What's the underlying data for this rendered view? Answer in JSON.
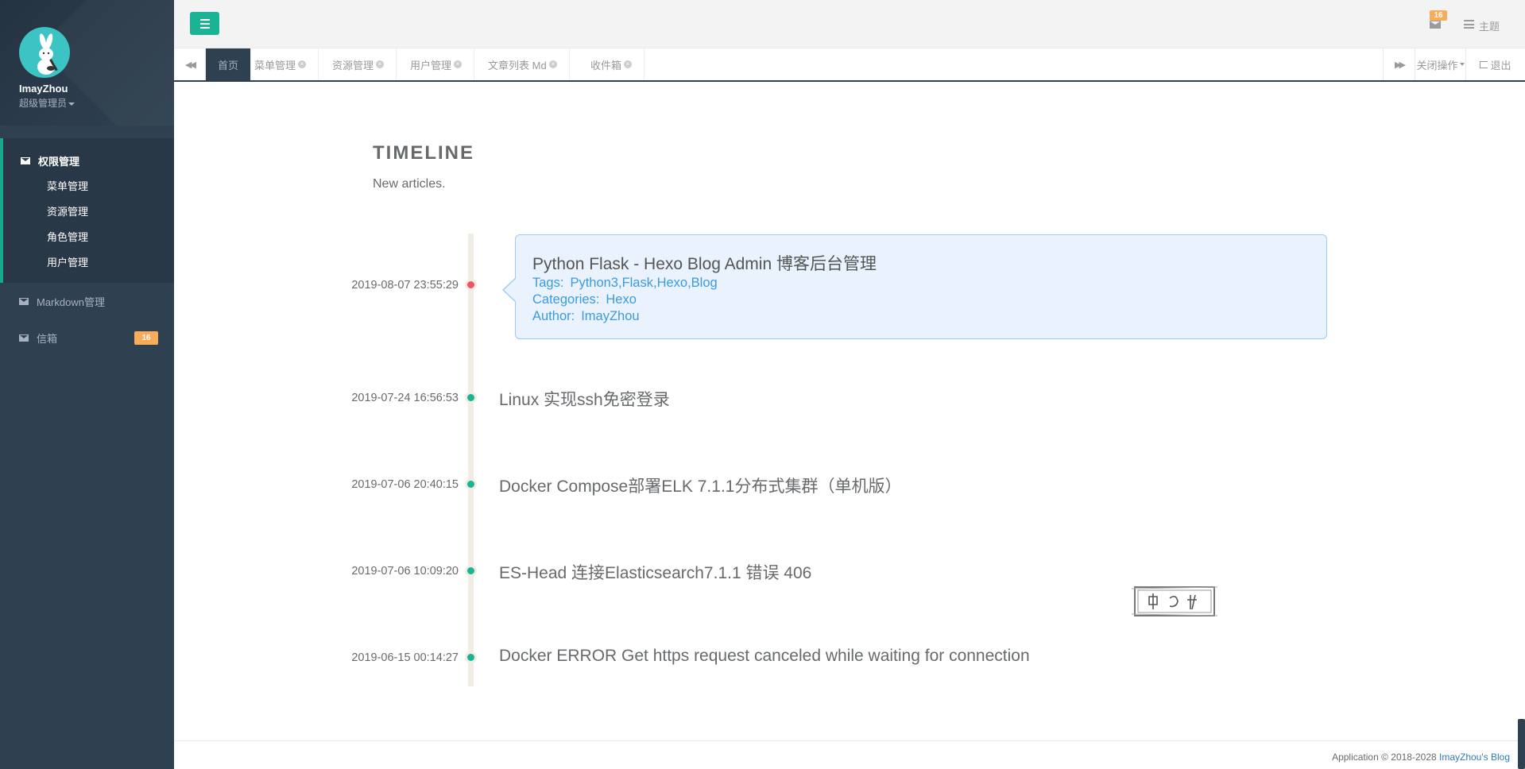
{
  "sidebar": {
    "user_name": "ImayZhou",
    "user_role": "超级管理员",
    "groups": [
      {
        "label": "权限管理",
        "items": [
          "菜单管理",
          "资源管理",
          "角色管理",
          "用户管理"
        ]
      }
    ],
    "markdown_label": "Markdown管理",
    "mailbox_label": "信箱",
    "mailbox_count": "16"
  },
  "topbar": {
    "mail_count": "16",
    "theme_label": "主题"
  },
  "tabs": [
    {
      "label": "首页",
      "active": true
    },
    {
      "label": "菜单管理"
    },
    {
      "label": "资源管理"
    },
    {
      "label": "用户管理"
    },
    {
      "label": "文章列表 Md"
    },
    {
      "label": "收件箱"
    }
  ],
  "tab_actions": {
    "close_ops": "关闭操作",
    "logout": "退出"
  },
  "timeline": {
    "title": "TIMELINE",
    "subtitle": "New articles.",
    "entries": [
      {
        "date": "2019-08-07 23:55:29",
        "title": "Python Flask - Hexo Blog Admin 博客后台管理",
        "tags_label": "Tags:",
        "tags": "Python3,Flask,Hexo,Blog",
        "categories_label": "Categories:",
        "categories": "Hexo",
        "author_label": "Author:",
        "author": "ImayZhou"
      },
      {
        "date": "2019-07-24 16:56:53",
        "title": "Linux 实现ssh免密登录"
      },
      {
        "date": "2019-07-06 20:40:15",
        "title": "Docker Compose部署ELK 7.1.1分布式集群（单机版）"
      },
      {
        "date": "2019-07-06 10:09:20",
        "title": "ES-Head 连接Elasticsearch7.1.1 错误 406"
      },
      {
        "date": "2019-06-15 00:14:27",
        "title": "Docker ERROR Get https request canceled while waiting for connection"
      }
    ]
  },
  "footer": {
    "text": "Application © 2018-2028 ",
    "link": "ImayZhou's Blog"
  },
  "colors": {
    "sidebar_bg": "#2f4050",
    "accent": "#1ab394",
    "badge": "#f8ac59",
    "card_bg": "#e9f2fd",
    "card_text": "#3b9be0"
  }
}
